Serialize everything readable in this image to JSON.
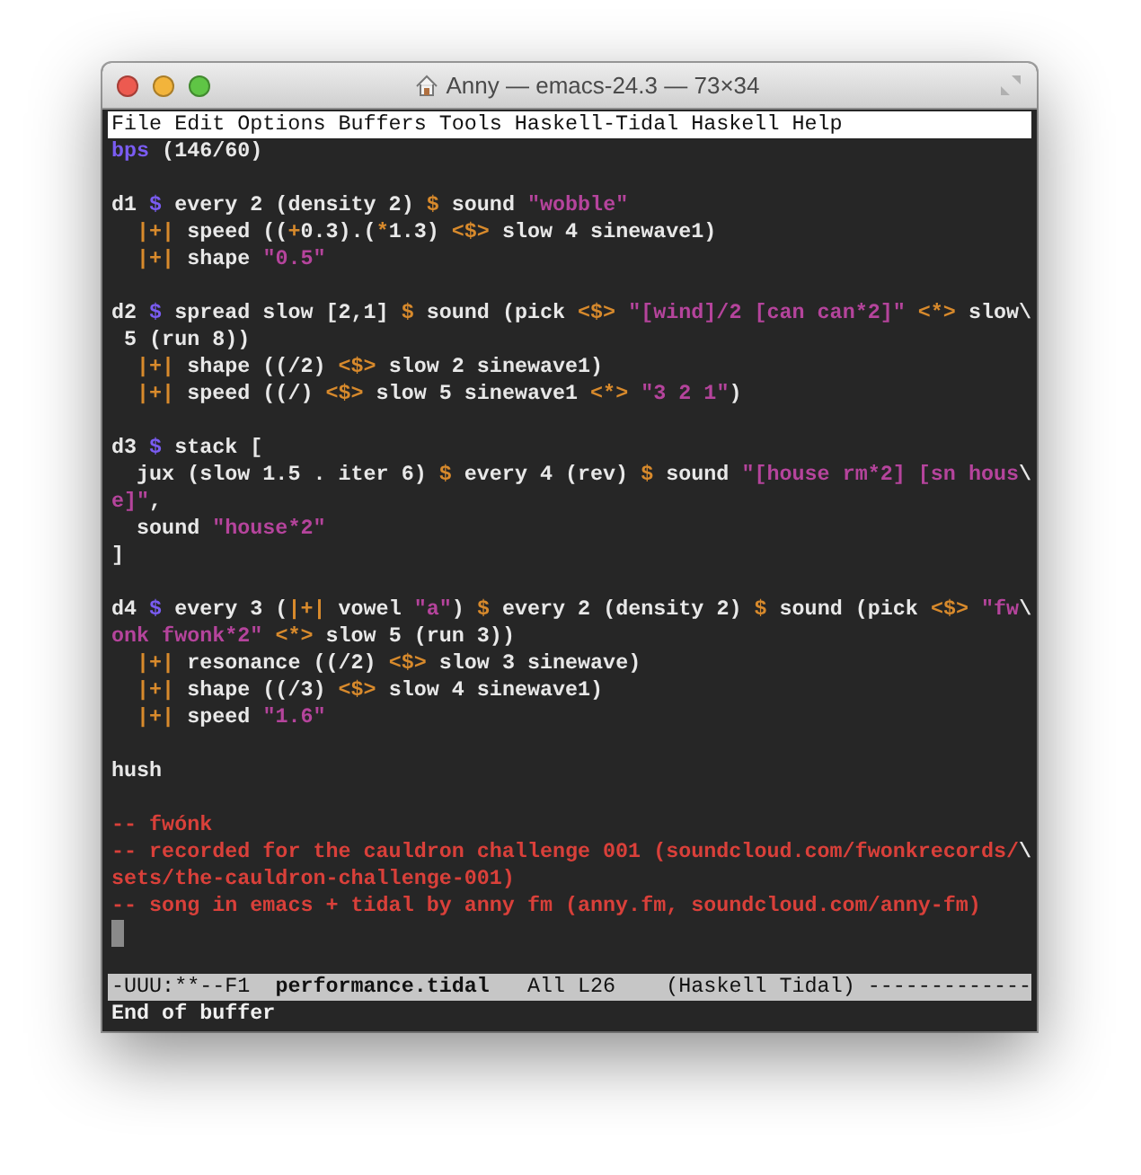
{
  "window": {
    "title": "Anny — emacs-24.3 — 73×34"
  },
  "menu": [
    "File",
    "Edit",
    "Options",
    "Buffers",
    "Tools",
    "Haskell-Tidal",
    "Haskell",
    "Help"
  ],
  "lines": [
    {
      "kind": "code",
      "tokens": [
        {
          "kind": "keyword",
          "text": "bps"
        },
        {
          "kind": "plain",
          "text": " (146/60)"
        }
      ]
    },
    {
      "kind": "blank"
    },
    {
      "kind": "code",
      "tokens": [
        {
          "kind": "plain",
          "text": "d1 "
        },
        {
          "kind": "keyword",
          "text": "$"
        },
        {
          "kind": "plain",
          "text": " every 2 (density 2) "
        },
        {
          "kind": "op",
          "text": "$"
        },
        {
          "kind": "plain",
          "text": " sound "
        },
        {
          "kind": "string",
          "text": "\"wobble\""
        }
      ]
    },
    {
      "kind": "code",
      "tokens": [
        {
          "kind": "op",
          "text": "  |+|"
        },
        {
          "kind": "plain",
          "text": " speed (("
        },
        {
          "kind": "op",
          "text": "+"
        },
        {
          "kind": "plain",
          "text": "0.3).("
        },
        {
          "kind": "op",
          "text": "*"
        },
        {
          "kind": "plain",
          "text": "1.3) "
        },
        {
          "kind": "op",
          "text": "<$>"
        },
        {
          "kind": "plain",
          "text": " slow 4 sinewave1)"
        }
      ]
    },
    {
      "kind": "code",
      "tokens": [
        {
          "kind": "op",
          "text": "  |+|"
        },
        {
          "kind": "plain",
          "text": " shape "
        },
        {
          "kind": "string",
          "text": "\"0.5\""
        }
      ]
    },
    {
      "kind": "blank"
    },
    {
      "kind": "code",
      "tokens": [
        {
          "kind": "plain",
          "text": "d2 "
        },
        {
          "kind": "keyword",
          "text": "$"
        },
        {
          "kind": "plain",
          "text": " spread slow [2,1] "
        },
        {
          "kind": "op",
          "text": "$"
        },
        {
          "kind": "plain",
          "text": " sound (pick "
        },
        {
          "kind": "op",
          "text": "<$>"
        },
        {
          "kind": "string",
          "text": " \"[wind]/2 [can can*2]\" "
        },
        {
          "kind": "op",
          "text": "<*>"
        },
        {
          "kind": "plain",
          "text": " slow\\"
        }
      ]
    },
    {
      "kind": "code",
      "tokens": [
        {
          "kind": "plain",
          "text": " 5 (run 8))"
        }
      ]
    },
    {
      "kind": "code",
      "tokens": [
        {
          "kind": "op",
          "text": "  |+|"
        },
        {
          "kind": "plain",
          "text": " shape ((/2) "
        },
        {
          "kind": "op",
          "text": "<$>"
        },
        {
          "kind": "plain",
          "text": " slow 2 sinewave1)"
        }
      ]
    },
    {
      "kind": "code",
      "tokens": [
        {
          "kind": "op",
          "text": "  |+|"
        },
        {
          "kind": "plain",
          "text": " speed ((/) "
        },
        {
          "kind": "op",
          "text": "<$>"
        },
        {
          "kind": "plain",
          "text": " slow 5 sinewave1 "
        },
        {
          "kind": "op",
          "text": "<*>"
        },
        {
          "kind": "string",
          "text": " \"3 2 1\""
        },
        {
          "kind": "plain",
          "text": ")"
        }
      ]
    },
    {
      "kind": "blank"
    },
    {
      "kind": "code",
      "tokens": [
        {
          "kind": "plain",
          "text": "d3 "
        },
        {
          "kind": "keyword",
          "text": "$"
        },
        {
          "kind": "plain",
          "text": " stack ["
        }
      ]
    },
    {
      "kind": "code",
      "tokens": [
        {
          "kind": "plain",
          "text": "  jux (slow 1.5 . iter 6) "
        },
        {
          "kind": "op",
          "text": "$"
        },
        {
          "kind": "plain",
          "text": " every 4 (rev) "
        },
        {
          "kind": "op",
          "text": "$"
        },
        {
          "kind": "plain",
          "text": " sound "
        },
        {
          "kind": "string",
          "text": "\"[house rm*2] [sn hous"
        },
        {
          "kind": "plain",
          "text": "\\"
        }
      ]
    },
    {
      "kind": "code",
      "tokens": [
        {
          "kind": "string",
          "text": "e]\""
        },
        {
          "kind": "plain",
          "text": ","
        }
      ]
    },
    {
      "kind": "code",
      "tokens": [
        {
          "kind": "plain",
          "text": "  sound "
        },
        {
          "kind": "string",
          "text": "\"house*2\""
        }
      ]
    },
    {
      "kind": "code",
      "tokens": [
        {
          "kind": "plain",
          "text": "]"
        }
      ]
    },
    {
      "kind": "blank"
    },
    {
      "kind": "code",
      "tokens": [
        {
          "kind": "plain",
          "text": "d4 "
        },
        {
          "kind": "keyword",
          "text": "$"
        },
        {
          "kind": "plain",
          "text": " every 3 ("
        },
        {
          "kind": "op",
          "text": "|+|"
        },
        {
          "kind": "plain",
          "text": " vowel "
        },
        {
          "kind": "string",
          "text": "\"a\""
        },
        {
          "kind": "plain",
          "text": ") "
        },
        {
          "kind": "op",
          "text": "$"
        },
        {
          "kind": "plain",
          "text": " every 2 (density 2) "
        },
        {
          "kind": "op",
          "text": "$"
        },
        {
          "kind": "plain",
          "text": " sound (pick "
        },
        {
          "kind": "op",
          "text": "<$>"
        },
        {
          "kind": "string",
          "text": " \"fw"
        },
        {
          "kind": "plain",
          "text": "\\"
        }
      ]
    },
    {
      "kind": "code",
      "tokens": [
        {
          "kind": "string",
          "text": "onk fwonk*2\" "
        },
        {
          "kind": "op",
          "text": "<*>"
        },
        {
          "kind": "plain",
          "text": " slow 5 (run 3))"
        }
      ]
    },
    {
      "kind": "code",
      "tokens": [
        {
          "kind": "op",
          "text": "  |+|"
        },
        {
          "kind": "plain",
          "text": " resonance ((/2) "
        },
        {
          "kind": "op",
          "text": "<$>"
        },
        {
          "kind": "plain",
          "text": " slow 3 sinewave)"
        }
      ]
    },
    {
      "kind": "code",
      "tokens": [
        {
          "kind": "op",
          "text": "  |+|"
        },
        {
          "kind": "plain",
          "text": " shape ((/3) "
        },
        {
          "kind": "op",
          "text": "<$>"
        },
        {
          "kind": "plain",
          "text": " slow 4 sinewave1)"
        }
      ]
    },
    {
      "kind": "code",
      "tokens": [
        {
          "kind": "op",
          "text": "  |+|"
        },
        {
          "kind": "plain",
          "text": " speed "
        },
        {
          "kind": "string",
          "text": "\"1.6\""
        }
      ]
    },
    {
      "kind": "blank"
    },
    {
      "kind": "code",
      "tokens": [
        {
          "kind": "plain",
          "text": "hush"
        }
      ]
    },
    {
      "kind": "blank"
    },
    {
      "kind": "code",
      "tokens": [
        {
          "kind": "comment",
          "text": "-- fwónk"
        }
      ]
    },
    {
      "kind": "code",
      "tokens": [
        {
          "kind": "comment",
          "text": "-- recorded for the cauldron challenge 001 (soundcloud.com/fwonkrecords/"
        },
        {
          "kind": "plain",
          "text": "\\"
        }
      ]
    },
    {
      "kind": "code",
      "tokens": [
        {
          "kind": "comment",
          "text": "sets/the-cauldron-challenge-001)"
        }
      ]
    },
    {
      "kind": "code",
      "tokens": [
        {
          "kind": "comment",
          "text": "-- song in emacs + tidal by anny fm (anny.fm, soundcloud.com/anny-fm)"
        }
      ]
    },
    {
      "kind": "cursor"
    }
  ],
  "mode_line": {
    "status": "-UUU:**--F1",
    "buffer": "performance.tidal",
    "position": "All L26",
    "mode": "(Haskell Tidal)",
    "fill": "-------------"
  },
  "echo_area": "End of buffer"
}
